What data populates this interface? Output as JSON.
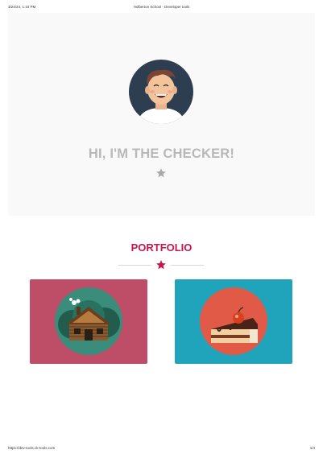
{
  "print_header": {
    "datetime": "3/24/24, 1:10 PM",
    "title": "Holberton School - Developer tools"
  },
  "print_footer": {
    "url": "https://dev-tools.ck-tools.com",
    "page": "1/4"
  },
  "hero": {
    "title": "HI, I'M THE CHECKER!",
    "star_icon": "star-icon"
  },
  "portfolio": {
    "title": "PORTFOLIO",
    "items": [
      {
        "icon": "log-cabin-icon",
        "background": "#be4d68"
      },
      {
        "icon": "cake-slice-icon",
        "background": "#20a4bc"
      }
    ]
  },
  "colors": {
    "accent": "#c7174a",
    "hero_text": "#b8b8b8",
    "hero_bg": "#f9f9f9"
  }
}
